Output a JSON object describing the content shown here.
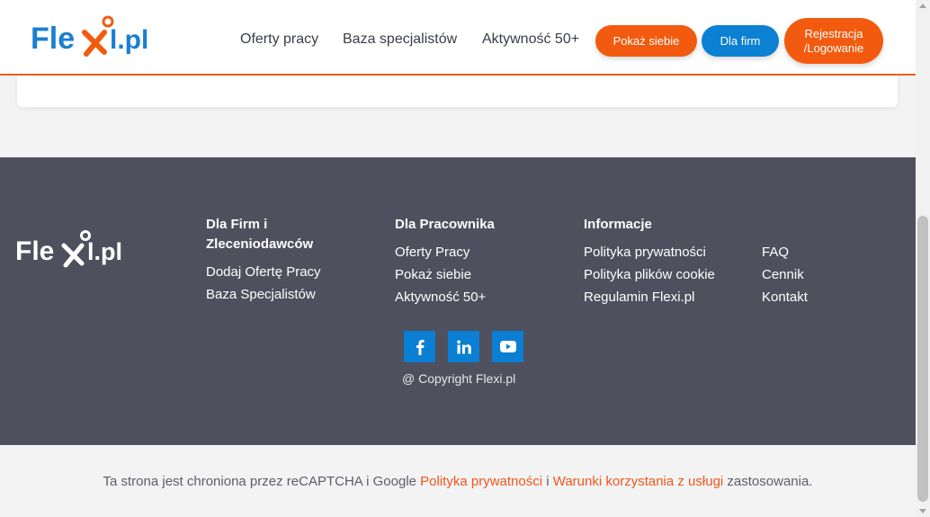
{
  "header": {
    "logo_text": "Flexi.pl",
    "nav": [
      {
        "label": "Oferty pracy"
      },
      {
        "label": "Baza specjalistów"
      },
      {
        "label": "Aktywność 50+"
      }
    ],
    "buttons": {
      "show_yourself": "Pokaż siebie",
      "for_companies": "Dla firm",
      "register_line1": "Rejestracja",
      "register_line2": "/Logowanie"
    }
  },
  "footer": {
    "logo_text": "Flexi.pl",
    "columns": [
      {
        "heading": "Dla Firm i Zleceniodawców",
        "links": [
          "Dodaj Ofertę Pracy",
          "Baza Specjalistów"
        ]
      },
      {
        "heading": "Dla Pracownika",
        "links": [
          "Oferty Pracy",
          "Pokaż siebie",
          "Aktywność 50+"
        ]
      },
      {
        "heading": "Informacje",
        "links": [
          "Polityka prywatności",
          "Polityka plików cookie",
          "Regulamin Flexi.pl"
        ]
      },
      {
        "heading": "",
        "links": [
          "FAQ",
          "Cennik",
          "Kontakt"
        ]
      }
    ],
    "socials": [
      "facebook-icon",
      "linkedin-icon",
      "youtube-icon"
    ],
    "copyright": "@ Copyright Flexi.pl"
  },
  "recaptcha": {
    "prefix": "Ta strona jest chroniona przez reCAPTCHA i Google ",
    "privacy_link": "Polityka prywatności",
    "separator": " i ",
    "terms_link": "Warunki korzystania z usługi",
    "suffix": " zastosowania."
  },
  "colors": {
    "brand_orange": "#f25b0f",
    "brand_blue": "#0c80d2",
    "footer_bg": "#4e505d"
  }
}
